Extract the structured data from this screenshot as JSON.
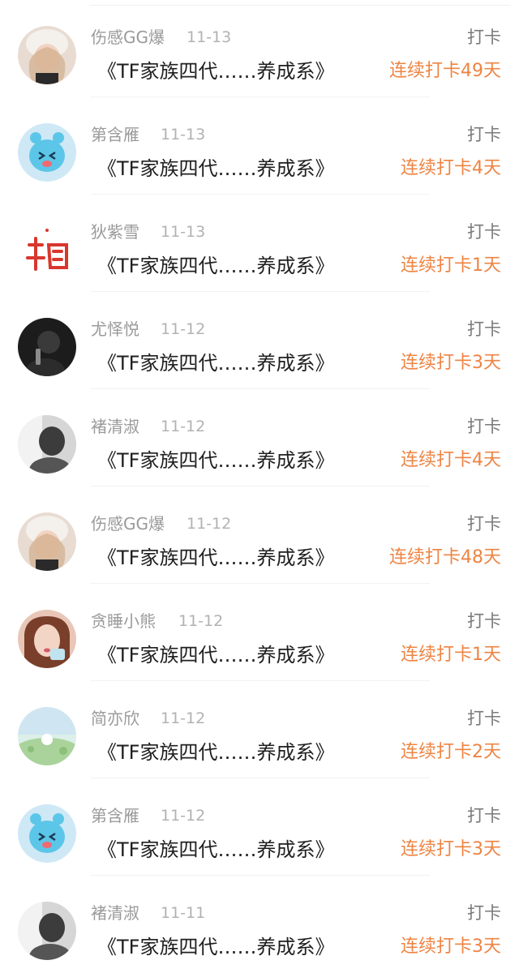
{
  "feed": {
    "items": [
      {
        "user": "伤感GG爆",
        "date": "11-13",
        "title": "《TF家族四代……养成系》",
        "action": "打卡",
        "streak": "连续打卡49天",
        "avatar": "girl-portrait-avatar"
      },
      {
        "user": "第含雁",
        "date": "11-13",
        "title": "《TF家族四代……养成系》",
        "action": "打卡",
        "streak": "连续打卡4天",
        "avatar": "blue-cartoon-bird-avatar"
      },
      {
        "user": "狄紫雪",
        "date": "11-13",
        "title": "《TF家族四代……养成系》",
        "action": "打卡",
        "streak": "连续打卡1天",
        "avatar": "red-calligraphy-avatar"
      },
      {
        "user": "尤怿悦",
        "date": "11-12",
        "title": "《TF家族四代……养成系》",
        "action": "打卡",
        "streak": "连续打卡3天",
        "avatar": "dark-selfie-avatar"
      },
      {
        "user": "褚清淑",
        "date": "11-12",
        "title": "《TF家族四代……养成系》",
        "action": "打卡",
        "streak": "连续打卡4天",
        "avatar": "monochrome-photo-avatar"
      },
      {
        "user": "伤感GG爆",
        "date": "11-12",
        "title": "《TF家族四代……养成系》",
        "action": "打卡",
        "streak": "连续打卡48天",
        "avatar": "girl-portrait-avatar"
      },
      {
        "user": "贪睡小熊",
        "date": "11-12",
        "title": "《TF家族四代……养成系》",
        "action": "打卡",
        "streak": "连续打卡1天",
        "avatar": "girl-selfie-avatar"
      },
      {
        "user": "简亦欣",
        "date": "11-12",
        "title": "《TF家族四代……养成系》",
        "action": "打卡",
        "streak": "连续打卡2天",
        "avatar": "pastel-landscape-avatar"
      },
      {
        "user": "第含雁",
        "date": "11-12",
        "title": "《TF家族四代……养成系》",
        "action": "打卡",
        "streak": "连续打卡3天",
        "avatar": "blue-cartoon-bird-avatar"
      },
      {
        "user": "褚清淑",
        "date": "11-11",
        "title": "《TF家族四代……养成系》",
        "action": "打卡",
        "streak": "连续打卡3天",
        "avatar": "monochrome-photo-avatar"
      }
    ]
  },
  "colors": {
    "streak": "#ee8443",
    "username": "#9a9a9a",
    "title": "#1f1f1f",
    "action": "#7a7a7a"
  }
}
